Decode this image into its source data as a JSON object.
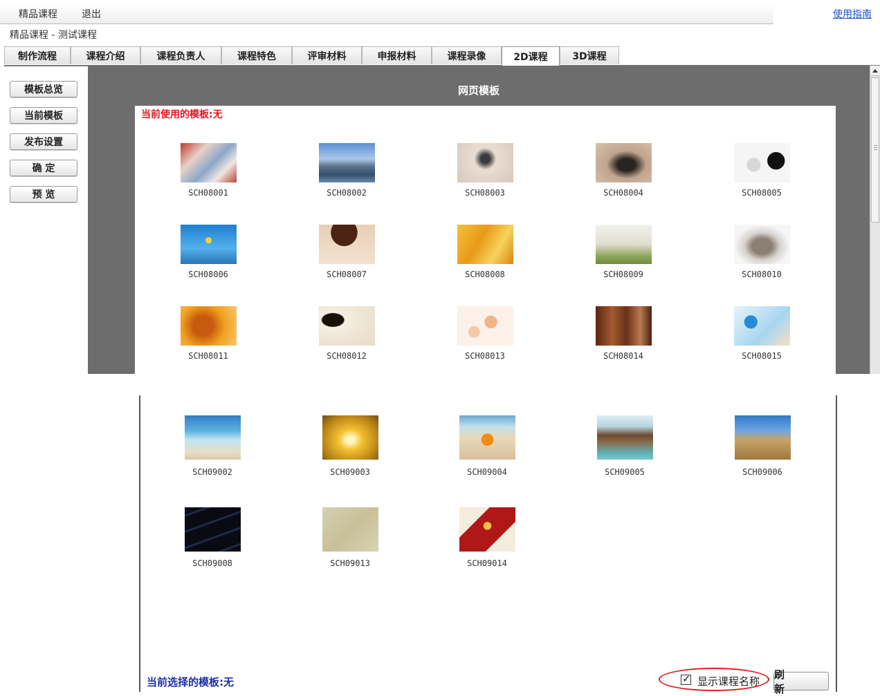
{
  "topbar": {
    "course_link": "精品课程",
    "logout_link": "退出",
    "guide_link": "使用指南"
  },
  "breadcrumb": "精品课程 - 测试课程",
  "tabs": [
    "制作流程",
    "课程介绍",
    "课程负责人",
    "课程特色",
    "评审材料",
    "申报材料",
    "课程录像",
    "2D课程",
    "3D课程"
  ],
  "active_tab": "2D课程",
  "sidebar": [
    "模板总览",
    "当前模板",
    "发布设置",
    "确 定",
    "预 览"
  ],
  "panel_title": "网页模板",
  "current_used": "当前使用的模板:无",
  "templates_top": [
    [
      "SCH08001",
      "SCH08002",
      "SCH08003",
      "SCH08004",
      "SCH08005"
    ],
    [
      "SCH08006",
      "SCH08007",
      "SCH08008",
      "SCH08009",
      "SCH08010"
    ],
    [
      "SCH08011",
      "SCH08012",
      "SCH08013",
      "SCH08014",
      "SCH08015"
    ]
  ],
  "templates_bottom": [
    [
      "SCH09002",
      "SCH09003",
      "SCH09004",
      "SCH09005",
      "SCH09006"
    ],
    [
      "SCH09008",
      "SCH09013",
      "SCH09014"
    ]
  ],
  "current_selected": "当前选择的模板:无",
  "show_course_name": {
    "label": "显示课程名称",
    "checked": true
  },
  "refresh_button": "刷 新"
}
